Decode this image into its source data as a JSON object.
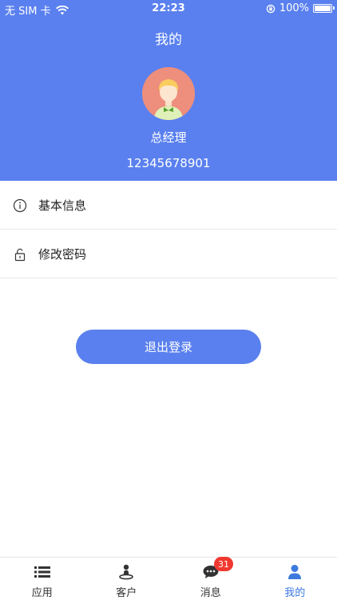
{
  "status_bar": {
    "carrier": "无 SIM 卡",
    "time": "22:23",
    "battery": "100%"
  },
  "header": {
    "title": "我的"
  },
  "profile": {
    "name": "总经理",
    "phone": "12345678901"
  },
  "menu": {
    "items": [
      {
        "label": "基本信息",
        "icon": "info-icon"
      },
      {
        "label": "修改密码",
        "icon": "lock-icon"
      }
    ]
  },
  "logout": {
    "label": "退出登录"
  },
  "tab_bar": {
    "tabs": [
      {
        "label": "应用",
        "icon": "list-icon"
      },
      {
        "label": "客户",
        "icon": "customer-icon"
      },
      {
        "label": "消息",
        "icon": "message-icon",
        "badge": "31"
      },
      {
        "label": "我的",
        "icon": "person-icon",
        "active": true
      }
    ]
  },
  "colors": {
    "primary": "#5a80ef",
    "active_tab": "#3d79de",
    "badge": "#f0382e"
  }
}
